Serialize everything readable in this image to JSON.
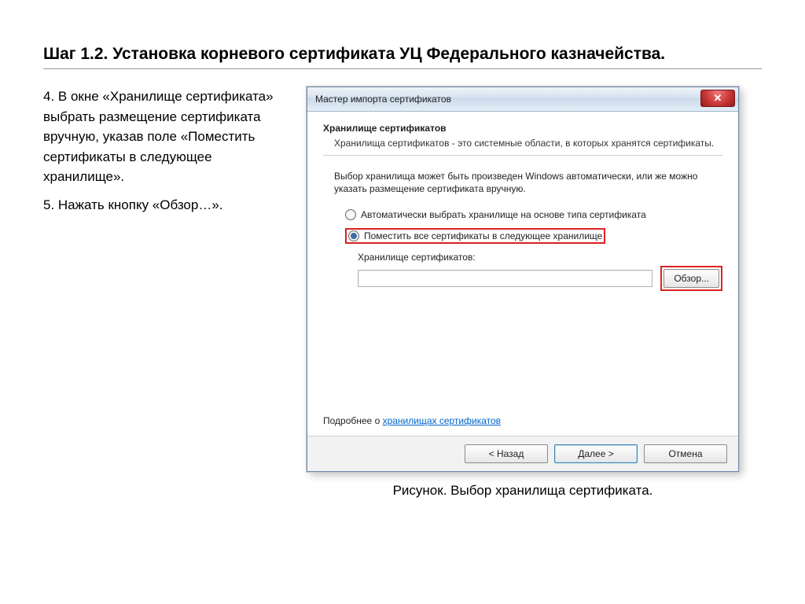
{
  "heading": "Шаг 1.2. Установка корневого сертификата УЦ Федерального казначейства.",
  "left": {
    "p1": "4. В окне «Хранилище сертификата» выбрать размещение сертификата вручную, указав поле «Поместить сертификаты в следующее хранилище».",
    "p2": "5. Нажать кнопку «Обзор…»."
  },
  "dialog": {
    "title": "Мастер импорта сертификатов",
    "section_title": "Хранилище сертификатов",
    "section_desc": "Хранилища сертификатов - это системные области, в которых хранятся сертификаты.",
    "intro": "Выбор хранилища может быть произведен Windows автоматически, или же можно указать размещение сертификата вручную.",
    "radio_auto": "Автоматически выбрать хранилище на основе типа сертификата",
    "radio_manual": "Поместить все сертификаты в следующее хранилище",
    "store_label": "Хранилище сертификатов:",
    "store_value": "",
    "browse": "Обзор...",
    "more_prefix": "Подробнее о ",
    "more_link": "хранилищах сертификатов",
    "back": "< Назад",
    "next": "Далее >",
    "cancel": "Отмена",
    "close_glyph": "✕"
  },
  "caption": "Рисунок. Выбор хранилища сертификата."
}
